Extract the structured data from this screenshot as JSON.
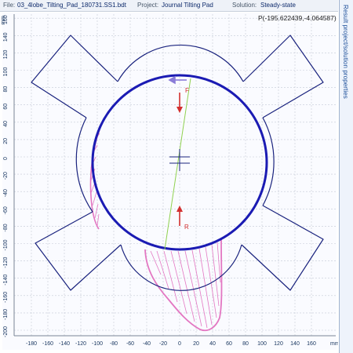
{
  "header": {
    "file_label": "File:",
    "file_name": "03_4lobe_Tilting_Pad_180731.SS1.bdt",
    "project_label": "Project:",
    "project_name": "Journal Tilting Pad",
    "solution_label": "Solution:",
    "solution_name": "Steady-state"
  },
  "side_tab": {
    "label": "Result project/solution properties"
  },
  "plot": {
    "cursor_readout": "P(-195.622439,-4.064587)",
    "x_unit": "mm",
    "y_unit": "mm",
    "x_ticks": [
      -180,
      -160,
      -140,
      -120,
      -100,
      -80,
      -60,
      -40,
      -20,
      0,
      20,
      40,
      60,
      80,
      100,
      120,
      140,
      160
    ],
    "y_ticks": [
      160,
      140,
      120,
      100,
      80,
      60,
      40,
      20,
      0,
      -20,
      -40,
      -60,
      -80,
      -100,
      -120,
      -140,
      -160,
      -180,
      -200
    ],
    "force_label": "F",
    "reaction_label": "R",
    "colors": {
      "grid": "#c4cad6",
      "bearing_outline": "#1a237e",
      "journal": "#1b1bb3",
      "pressure": "#e377c2",
      "center_line": "#8fd14f",
      "force_arrow": "#d32f2f",
      "rotation_arrow": "#8a7cd8"
    }
  }
}
